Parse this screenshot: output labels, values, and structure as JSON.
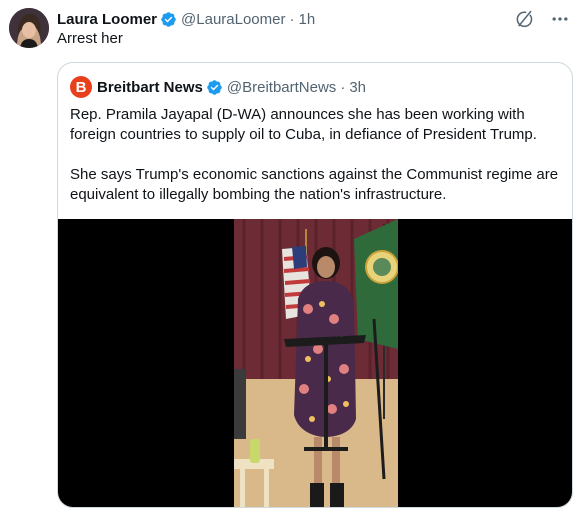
{
  "tweet": {
    "author_name": "Laura Loomer",
    "handle": "@LauraLoomer",
    "separator": "·",
    "time": "1h",
    "text": "Arrest her"
  },
  "quote": {
    "author_name": "Breitbart News",
    "logo_letter": "B",
    "handle": "@BreitbartNews",
    "separator": "·",
    "time": "3h",
    "paragraph1": "Rep. Pramila Jayapal (D-WA) announces she has been working with foreign countries to supply oil to Cuba, in defiance of President Trump.",
    "paragraph2": "She says Trump's economic sanctions against the Communist regime are equivalent to illegally bombing the nation's infrastructure."
  },
  "icons": {
    "verified": "verified-badge-icon",
    "grok": "grok-icon",
    "more": "more-icon"
  },
  "colors": {
    "verified_blue": "#1d9bf0",
    "breitbart_orange": "#e8401d",
    "text_secondary": "#536471",
    "border": "#cfd9de"
  }
}
